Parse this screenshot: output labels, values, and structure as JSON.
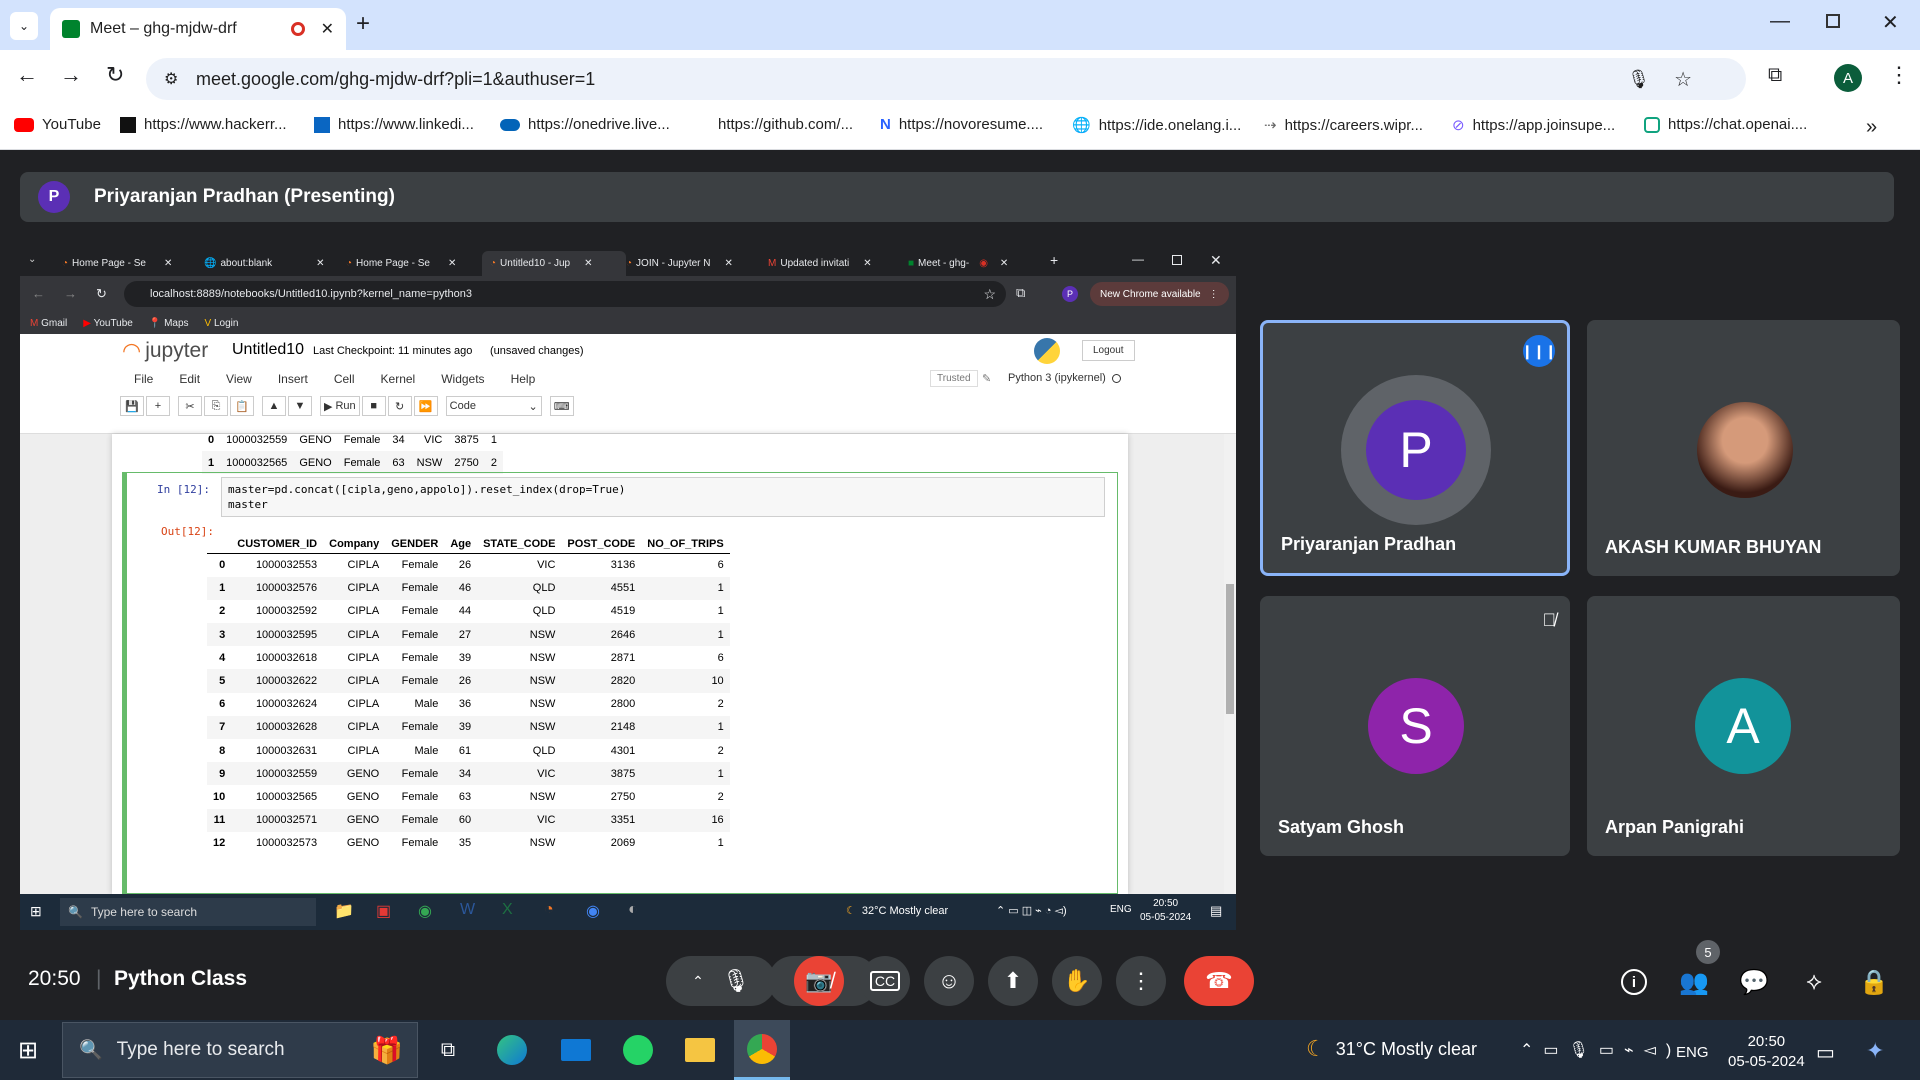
{
  "browser": {
    "tab_title": "Meet – ghg-mjdw-drf",
    "url": "meet.google.com/ghg-mjdw-drf?pli=1&authuser=1",
    "profile_initial": "A",
    "bookmarks": [
      "YouTube",
      "https://www.hackerr...",
      "https://www.linkedi...",
      "https://onedrive.live...",
      "https://github.com/...",
      "https://novoresume....",
      "https://ide.onelang.i...",
      "https://careers.wipr...",
      "https://app.joinsupe...",
      "https://chat.openai...."
    ]
  },
  "meet": {
    "presenter_initial": "P",
    "presenting_label": "Priyaranjan Pradhan (Presenting)",
    "time": "20:50",
    "meeting_title": "Python Class",
    "participant_count": "5",
    "participants": [
      {
        "name": "Priyaranjan Pradhan",
        "initial": "P",
        "color": "#5b2fb5"
      },
      {
        "name": "AKASH KUMAR BHUYAN",
        "initial": "",
        "color": "#7a2a3a"
      },
      {
        "name": "Satyam Ghosh",
        "initial": "S",
        "color": "#8e24aa"
      },
      {
        "name": "Arpan Panigrahi",
        "initial": "A",
        "color": "#12939a"
      }
    ]
  },
  "shared": {
    "tabs": [
      "Home Page - Se",
      "about:blank",
      "Home Page - Se",
      "Untitled10 - Jup",
      "JOIN - Jupyter N",
      "Updated invitati",
      "Meet - ghg-"
    ],
    "url": "localhost:8889/notebooks/Untitled10.ipynb?kernel_name=python3",
    "new_chrome": "New Chrome available",
    "bookmarks": [
      "Gmail",
      "YouTube",
      "Maps",
      "Login"
    ],
    "jupyter": {
      "logo": "jupyter",
      "name": "Untitled10",
      "checkpoint": "Last Checkpoint: 11 minutes ago",
      "unsaved": "(unsaved changes)",
      "logout": "Logout",
      "menu": [
        "File",
        "Edit",
        "View",
        "Insert",
        "Cell",
        "Kernel",
        "Widgets",
        "Help"
      ],
      "trusted": "Trusted",
      "kernel": "Python 3 (ipykernel)",
      "run": "Run",
      "cell_type": "Code",
      "prev_rows": [
        [
          "0",
          "1000032559",
          "GENO",
          "Female",
          "34",
          "VIC",
          "3875",
          "1"
        ],
        [
          "1",
          "1000032565",
          "GENO",
          "Female",
          "63",
          "NSW",
          "2750",
          "2"
        ]
      ],
      "in_prompt": "In [12]:",
      "code_line1": "master=pd.concat([cipla,geno,appolo]).reset_index(drop=True)",
      "code_line2": "master",
      "out_prompt": "Out[12]:",
      "columns": [
        "",
        "CUSTOMER_ID",
        "Company",
        "GENDER",
        "Age",
        "STATE_CODE",
        "POST_CODE",
        "NO_OF_TRIPS"
      ],
      "rows": [
        [
          "0",
          "1000032553",
          "CIPLA",
          "Female",
          "26",
          "VIC",
          "3136",
          "6"
        ],
        [
          "1",
          "1000032576",
          "CIPLA",
          "Female",
          "46",
          "QLD",
          "4551",
          "1"
        ],
        [
          "2",
          "1000032592",
          "CIPLA",
          "Female",
          "44",
          "QLD",
          "4519",
          "1"
        ],
        [
          "3",
          "1000032595",
          "CIPLA",
          "Female",
          "27",
          "NSW",
          "2646",
          "1"
        ],
        [
          "4",
          "1000032618",
          "CIPLA",
          "Female",
          "39",
          "NSW",
          "2871",
          "6"
        ],
        [
          "5",
          "1000032622",
          "CIPLA",
          "Female",
          "26",
          "NSW",
          "2820",
          "10"
        ],
        [
          "6",
          "1000032624",
          "CIPLA",
          "Male",
          "36",
          "NSW",
          "2800",
          "2"
        ],
        [
          "7",
          "1000032628",
          "CIPLA",
          "Female",
          "39",
          "NSW",
          "2148",
          "1"
        ],
        [
          "8",
          "1000032631",
          "CIPLA",
          "Male",
          "61",
          "QLD",
          "4301",
          "2"
        ],
        [
          "9",
          "1000032559",
          "GENO",
          "Female",
          "34",
          "VIC",
          "3875",
          "1"
        ],
        [
          "10",
          "1000032565",
          "GENO",
          "Female",
          "63",
          "NSW",
          "2750",
          "2"
        ],
        [
          "11",
          "1000032571",
          "GENO",
          "Female",
          "60",
          "VIC",
          "3351",
          "16"
        ],
        [
          "12",
          "1000032573",
          "GENO",
          "Female",
          "35",
          "NSW",
          "2069",
          "1"
        ]
      ]
    },
    "taskbar": {
      "search": "Type here to search",
      "weather": "32°C  Mostly clear",
      "lang": "ENG",
      "time": "20:50",
      "date": "05-05-2024"
    }
  },
  "taskbar": {
    "search": "Type here to search",
    "weather": "31°C  Mostly clear",
    "lang": "ENG",
    "time": "20:50",
    "date": "05-05-2024"
  }
}
